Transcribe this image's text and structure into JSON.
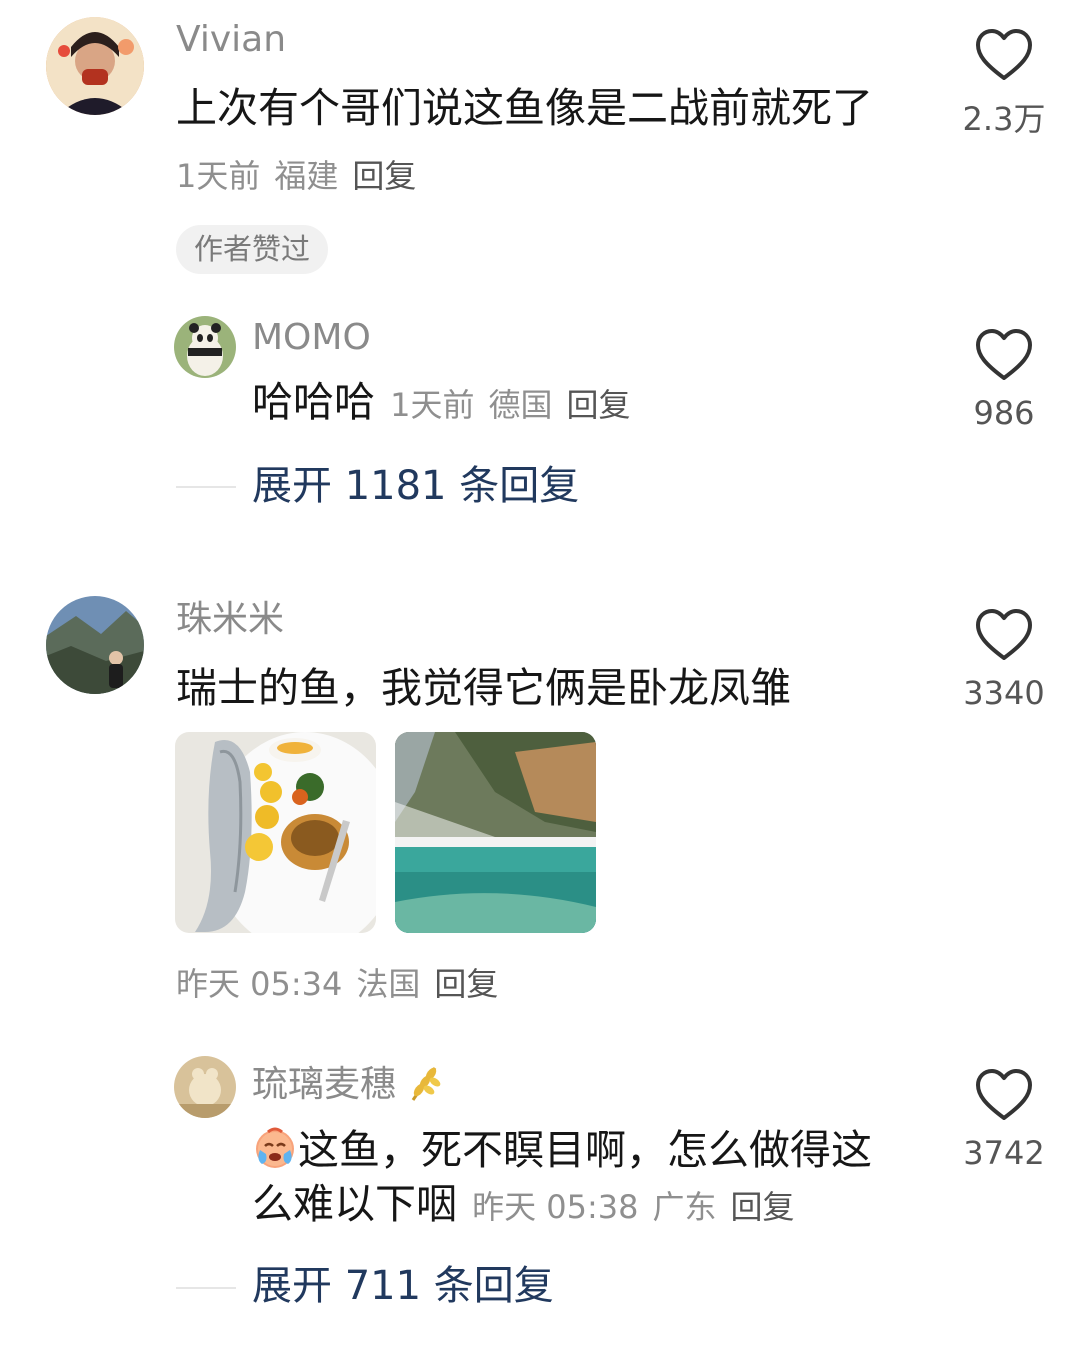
{
  "comments": [
    {
      "username": "Vivian",
      "text": "上次有个哥们说这鱼像是二战前就死了",
      "time": "1天前",
      "location": "福建",
      "reply_label": "回复",
      "likes": "2.3万",
      "badge": "作者赞过",
      "replies": [
        {
          "username": "MOMO",
          "text": "哈哈哈",
          "time": "1天前",
          "location": "德国",
          "reply_label": "回复",
          "likes": "986"
        }
      ],
      "expand_label": "展开 1181 条回复"
    },
    {
      "username": "珠米米",
      "text": "瑞士的鱼，我觉得它俩是卧龙凤雏",
      "time": "昨天 05:34",
      "location": "法国",
      "reply_label": "回复",
      "likes": "3340",
      "images": [
        "grilled-fish-plate",
        "turquoise-lake-forest"
      ],
      "replies": [
        {
          "username": "琉璃麦穗",
          "username_icon": "wheat-icon",
          "text_line1": "这鱼，死不瞑目啊，怎么做得这",
          "text_line2": "么难以下咽",
          "emoji": "crying-face-icon",
          "time": "昨天 05:38",
          "location": "广东",
          "reply_label": "回复",
          "likes": "3742"
        }
      ],
      "expand_label": "展开 711 条回复"
    }
  ],
  "colors": {
    "expand_link": "#21395e",
    "meta_text": "#8f8f8f",
    "username": "#8a8a8a"
  }
}
